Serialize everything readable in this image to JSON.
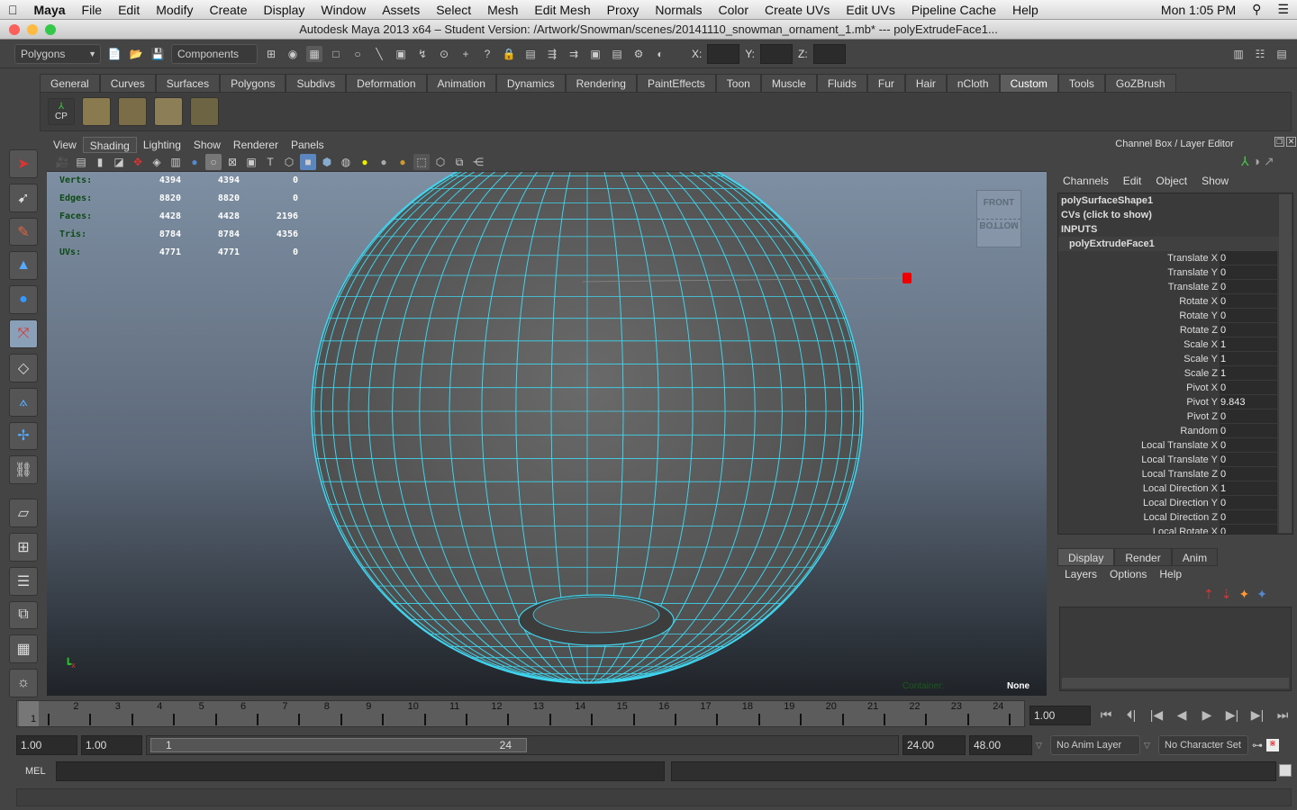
{
  "menubar": {
    "app": "Maya",
    "items": [
      "File",
      "Edit",
      "Modify",
      "Create",
      "Display",
      "Window",
      "Assets",
      "Select",
      "Mesh",
      "Edit Mesh",
      "Proxy",
      "Normals",
      "Color",
      "Create UVs",
      "Edit UVs",
      "Pipeline Cache",
      "Help"
    ],
    "clock": "Mon 1:05 PM"
  },
  "window": {
    "title": "Autodesk Maya 2013 x64 – Student Version: /Artwork/Snowman/scenes/20141110_snowman_ornament_1.mb*  ---  polyExtrudeFace1..."
  },
  "statusline": {
    "menuset": "Polygons",
    "selection_mode": "Components",
    "x_label": "X:",
    "y_label": "Y:",
    "z_label": "Z:"
  },
  "shelf": {
    "tabs": [
      "General",
      "Curves",
      "Surfaces",
      "Polygons",
      "Subdivs",
      "Deformation",
      "Animation",
      "Dynamics",
      "Rendering",
      "PaintEffects",
      "Toon",
      "Muscle",
      "Fluids",
      "Fur",
      "Hair",
      "nCloth",
      "Custom",
      "Tools",
      "GoZBrush"
    ],
    "active": "Custom",
    "cp_label": "CP"
  },
  "viewport": {
    "menu": [
      "View",
      "Shading",
      "Lighting",
      "Show",
      "Renderer",
      "Panels"
    ],
    "active_menu": "Shading",
    "hud": [
      {
        "label": "Verts:",
        "a": "4394",
        "b": "4394",
        "c": "0"
      },
      {
        "label": "Edges:",
        "a": "8820",
        "b": "8820",
        "c": "0"
      },
      {
        "label": "Faces:",
        "a": "4428",
        "b": "4428",
        "c": "2196"
      },
      {
        "label": "Tris:",
        "a": "8784",
        "b": "8784",
        "c": "4356"
      },
      {
        "label": "UVs:",
        "a": "4771",
        "b": "4771",
        "c": "0"
      }
    ],
    "viewcube_front": "FRONT",
    "viewcube_bottom": "BOTTOM",
    "container_label": "Container:",
    "container_value": "None",
    "wire_color": "#3fd6f0"
  },
  "channelbox": {
    "header": "Channel Box / Layer Editor",
    "menu": [
      "Channels",
      "Edit",
      "Object",
      "Show"
    ],
    "shape": "polySurfaceShape1",
    "cvs": "CVs (click to show)",
    "inputs": "INPUTS",
    "node": "polyExtrudeFace1",
    "attributes": [
      {
        "name": "Translate X",
        "value": "0"
      },
      {
        "name": "Translate Y",
        "value": "0"
      },
      {
        "name": "Translate Z",
        "value": "0"
      },
      {
        "name": "Rotate X",
        "value": "0"
      },
      {
        "name": "Rotate Y",
        "value": "0"
      },
      {
        "name": "Rotate Z",
        "value": "0"
      },
      {
        "name": "Scale X",
        "value": "1"
      },
      {
        "name": "Scale Y",
        "value": "1"
      },
      {
        "name": "Scale Z",
        "value": "1"
      },
      {
        "name": "Pivot X",
        "value": "0"
      },
      {
        "name": "Pivot Y",
        "value": "9.843"
      },
      {
        "name": "Pivot Z",
        "value": "0"
      },
      {
        "name": "Random",
        "value": "0"
      },
      {
        "name": "Local Translate X",
        "value": "0"
      },
      {
        "name": "Local Translate Y",
        "value": "0"
      },
      {
        "name": "Local Translate Z",
        "value": "0"
      },
      {
        "name": "Local Direction X",
        "value": "1"
      },
      {
        "name": "Local Direction Y",
        "value": "0"
      },
      {
        "name": "Local Direction Z",
        "value": "0"
      },
      {
        "name": "Local Rotate X",
        "value": "0"
      }
    ]
  },
  "layereditor": {
    "tabs": [
      "Display",
      "Render",
      "Anim"
    ],
    "active": "Display",
    "menu": [
      "Layers",
      "Options",
      "Help"
    ]
  },
  "timeline": {
    "ticks": [
      "1",
      "2",
      "3",
      "4",
      "5",
      "6",
      "7",
      "8",
      "9",
      "10",
      "11",
      "12",
      "13",
      "14",
      "15",
      "16",
      "17",
      "18",
      "19",
      "20",
      "21",
      "22",
      "23",
      "24"
    ],
    "current_frame_marker": "1",
    "current_time": "1.00"
  },
  "range": {
    "start": "1.00",
    "playback_start": "1.00",
    "slider_start": "1",
    "slider_end": "24",
    "playback_end": "24.00",
    "end": "48.00",
    "anim_layer": "No Anim Layer",
    "character_set": "No Character Set"
  },
  "commandline": {
    "label": "MEL"
  }
}
